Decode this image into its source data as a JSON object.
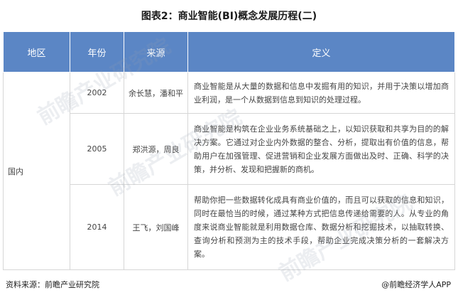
{
  "title": "图表2：商业智能(BI)概念发展历程(二)",
  "table": {
    "headers": [
      "地区",
      "年份",
      "来源",
      "定义"
    ],
    "region": "国内",
    "rows": [
      {
        "year": "2002",
        "source": "余长慧，潘和平",
        "definition": "商业智能是从大量的数据和信息中发掘有用的知识，并用于决策以增加商业利润，是一个从数据到信息到知识的处理过程。"
      },
      {
        "year": "2005",
        "source": "郑洪源，周良",
        "definition": "商业智能是构筑在企业业务系统基础之上，以知识获取和共享为目的的解决方案。它通过对企业内外数据的整合、分析，提取出有价值的信息，帮助用户在加强管理、促进营销和企业发展方面做出及时、正确、科学的决策，并分析、发现和把握新的商机。"
      },
      {
        "year": "2014",
        "source": "王飞，刘国峰",
        "definition": "帮助你把一些数据转化成具有商业价值的，而且可以获取的信息和知识，同时在最恰当的时候，通过某种方式把信息传递给需要的人。从专业的角度来说商业智能就是利用数据仓库、数据分析和挖掘技术，以抽取转换、查询分析和预测为主的技术手段，帮助企业完成决策分析的一套解决方案。"
      }
    ]
  },
  "footer": {
    "source": "资料来源：前瞻产业研究院",
    "brand": "@前瞻经济学人APP"
  },
  "watermark": "前瞻产业研究院"
}
